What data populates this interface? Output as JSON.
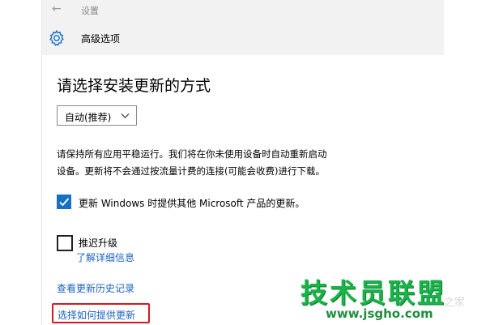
{
  "titlebar": {
    "back_icon": "←",
    "title": "设置"
  },
  "header": {
    "icon": "gear-icon",
    "title": "高级选项"
  },
  "section": {
    "title": "请选择安装更新的方式"
  },
  "install_mode": {
    "selected": "自动(推荐)"
  },
  "description": {
    "line1": "请保持所有应用平稳运行。我们将在你未使用设备时自动重新启动",
    "line2": "设备。更新将不会通过按流量计费的连接(可能会收费)进行下载。"
  },
  "options": {
    "other_products": {
      "label": "更新 Windows 时提供其他 Microsoft 产品的更新。",
      "checked": true
    },
    "defer_upgrades": {
      "label": "推迟升级",
      "checked": false,
      "learn_more": "了解详细信息"
    }
  },
  "links": {
    "history": "查看更新历史记录",
    "choose_delivery": "选择如何提供更新"
  },
  "watermark": {
    "text": "技术员联盟",
    "url": "www.jsgho.com",
    "faint": "之家"
  },
  "colors": {
    "accent": "#1570c6",
    "link": "#1a62c2",
    "highlight_border": "#d4181f",
    "watermark": "#1ab34a"
  }
}
